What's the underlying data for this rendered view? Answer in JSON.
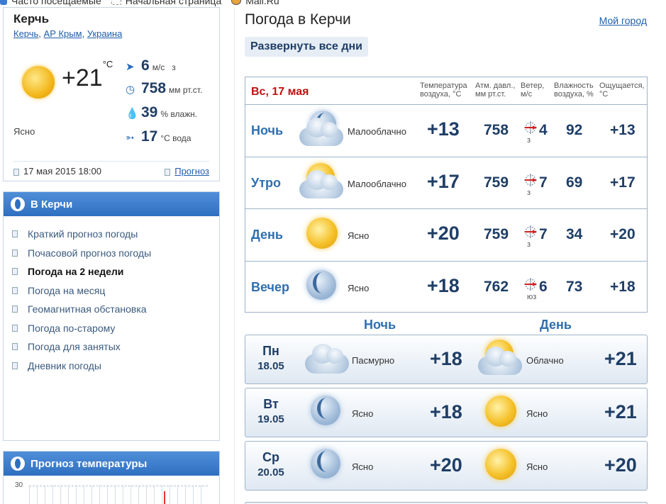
{
  "bookmarks": [
    "Часто посещаемые",
    "Начальная страница",
    "Mail.Ru"
  ],
  "city": {
    "name": "Керчь",
    "path": [
      "Керчь",
      "АР Крым",
      "Украина"
    ],
    "temp": "+21",
    "temp_unit": "°C",
    "condition": "Ясно",
    "wind_value": "6",
    "wind_unit": "м/с",
    "wind_dir": "з",
    "pressure_value": "758",
    "pressure_unit": "мм рт.ст.",
    "humidity_value": "39",
    "humidity_unit": "% влажн.",
    "water_value": "17",
    "water_unit": "°С вода",
    "updated": "17 мая 2015 18:00",
    "forecast_link": "Прогноз"
  },
  "menu": {
    "title": "В Керчи",
    "items": [
      {
        "label": "Краткий прогноз погоды",
        "active": false
      },
      {
        "label": "Почасовой прогноз погоды",
        "active": false
      },
      {
        "label": "Погода на 2 недели",
        "active": true
      },
      {
        "label": "Погода на месяц",
        "active": false
      },
      {
        "label": "Геомагнитная обстановка",
        "active": false
      },
      {
        "label": "Погода по-старому",
        "active": false
      },
      {
        "label": "Погода для занятых",
        "active": false
      },
      {
        "label": "Дневник погоды",
        "active": false
      }
    ]
  },
  "temp_forecast": {
    "title": "Прогноз температуры",
    "axis_label": "30"
  },
  "main": {
    "title": "Погода в Керчи",
    "my_city": "Мой город",
    "expand_label": "Развернуть все дни",
    "today": {
      "date": "Вс, 17 мая",
      "columns": [
        {
          "line1": "Температура",
          "line2": "воздуха, °С"
        },
        {
          "line1": "Атм. давл.,",
          "line2": "мм рт.ст."
        },
        {
          "line1": "Ветер,",
          "line2": "м/с"
        },
        {
          "line1": "Влажность",
          "line2": "воздуха, %"
        },
        {
          "line1": "Ощущается,",
          "line2": "°С"
        }
      ],
      "rows": [
        {
          "part": "Ночь",
          "icon": "moon-cloud-icon",
          "cond": "Малооблачно",
          "temp": "+13",
          "pressure": "758",
          "wind": "4",
          "wind_dir": "з",
          "humidity": "92",
          "feels": "+13"
        },
        {
          "part": "Утро",
          "icon": "sun-cloud-icon",
          "cond": "Малооблачно",
          "temp": "+17",
          "pressure": "759",
          "wind": "7",
          "wind_dir": "з",
          "humidity": "69",
          "feels": "+17"
        },
        {
          "part": "День",
          "icon": "sun-icon",
          "cond": "Ясно",
          "temp": "+20",
          "pressure": "759",
          "wind": "7",
          "wind_dir": "з",
          "humidity": "34",
          "feels": "+20"
        },
        {
          "part": "Вечер",
          "icon": "moon-icon",
          "cond": "Ясно",
          "temp": "+18",
          "pressure": "762",
          "wind": "6",
          "wind_dir": "юз",
          "humidity": "73",
          "feels": "+18"
        }
      ]
    },
    "night_label": "Ночь",
    "day_label": "День",
    "forecast": [
      {
        "dow": "Пн",
        "date": "18.05",
        "night_icon": "cloud-icon",
        "night_cond": "Пасмурно",
        "night_temp": "+18",
        "day_icon": "sun-cloud-icon",
        "day_cond": "Облачно",
        "day_temp": "+21"
      },
      {
        "dow": "Вт",
        "date": "19.05",
        "night_icon": "moon-icon",
        "night_cond": "Ясно",
        "night_temp": "+18",
        "day_icon": "sun-icon",
        "day_cond": "Ясно",
        "day_temp": "+21"
      },
      {
        "dow": "Ср",
        "date": "20.05",
        "night_icon": "moon-icon",
        "night_cond": "Ясно",
        "night_temp": "+20",
        "day_icon": "sun-icon",
        "day_cond": "Ясно",
        "day_temp": "+20"
      }
    ]
  }
}
